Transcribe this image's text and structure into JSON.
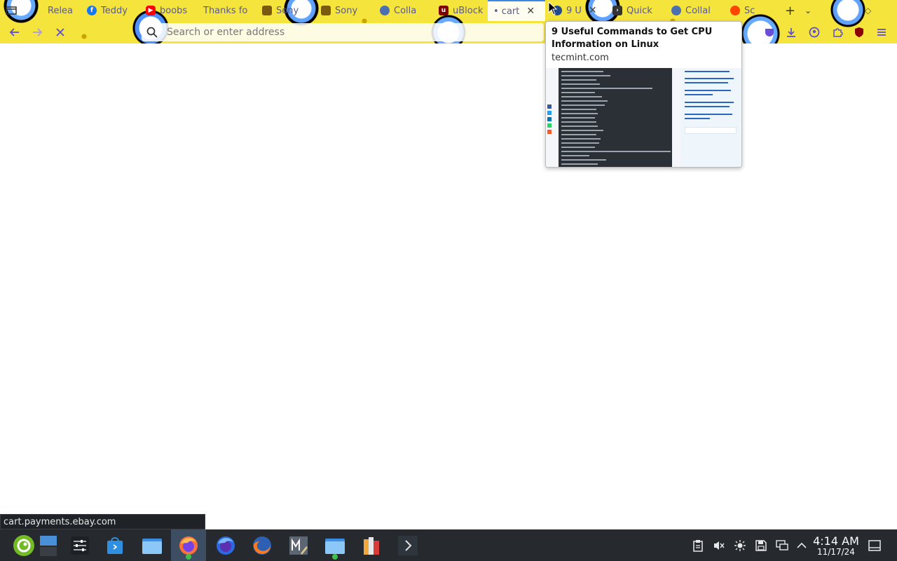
{
  "browser": {
    "tabs": [
      {
        "label": "Relea",
        "icon": "release-icon"
      },
      {
        "label": "Teddy",
        "icon": "facebook-icon"
      },
      {
        "label": "boobs",
        "icon": "youtube-icon"
      },
      {
        "label": "Thanks fo",
        "icon": "blank-icon"
      },
      {
        "label": "Sony",
        "icon": "shopping-bag-icon"
      },
      {
        "label": "Sony",
        "icon": "shopping-bag-icon"
      },
      {
        "label": "Colla",
        "icon": "search-icon"
      },
      {
        "label": "uBlock",
        "icon": "ublock-icon"
      },
      {
        "label": "• cart",
        "icon": "loading-icon",
        "active": true,
        "close": "✕"
      },
      {
        "label": "9 U",
        "icon": "tecmint-icon",
        "close": "✕"
      },
      {
        "label": "Quick",
        "icon": "terminal-icon"
      },
      {
        "label": "Collal",
        "icon": "search-icon"
      },
      {
        "label": "Sc",
        "icon": "reddit-icon"
      }
    ],
    "address_placeholder": "Search or enter address"
  },
  "tab_preview": {
    "title": "9 Useful Commands to Get CPU Information on Linux",
    "host": "tecmint.com"
  },
  "status_text": "cart.payments.ebay.com",
  "taskbar": {
    "clock_time": "4:14 AM",
    "clock_date": "11/17/24"
  },
  "colors": {
    "theme_yellow": "#f5e43c",
    "active_tab_accent": "#3b87e6",
    "nav_icon": "#5c4bd8",
    "taskbar_bg": "#262a2f",
    "taskbar_active": "#3d4e63"
  }
}
